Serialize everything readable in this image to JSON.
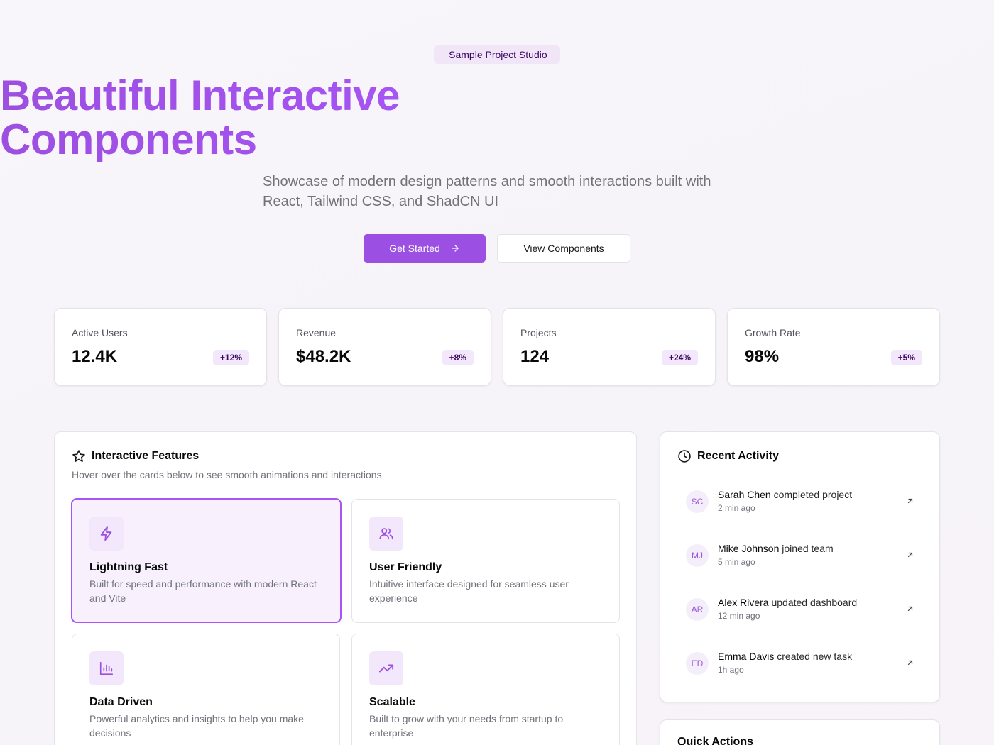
{
  "hero": {
    "badge": " Sample Project Studio",
    "title_line1": "Beautiful Interactive",
    "title_line2": "Components",
    "subtitle": "Showcase of modern design patterns and smooth interactions built with React, Tailwind CSS, and ShadCN UI",
    "primary_button": "Get Started",
    "secondary_button": "View Components"
  },
  "stats": [
    {
      "label": "Active Users",
      "value": "12.4K",
      "delta": "+12%"
    },
    {
      "label": "Revenue",
      "value": "$48.2K",
      "delta": "+8%"
    },
    {
      "label": "Projects",
      "value": "124",
      "delta": "+24%"
    },
    {
      "label": "Growth Rate",
      "value": "98%",
      "delta": "+5%"
    }
  ],
  "features": {
    "title": "Interactive Features",
    "description": "Hover over the cards below to see smooth animations and interactions",
    "cards": [
      {
        "name": "Lightning Fast",
        "description": "Built for speed and performance with modern React and Vite",
        "icon": "lightning-icon"
      },
      {
        "name": "User Friendly",
        "description": "Intuitive interface designed for seamless user experience",
        "icon": "users-icon"
      },
      {
        "name": "Data Driven",
        "description": "Powerful analytics and insights to help you make decisions",
        "icon": "bar-chart-icon"
      },
      {
        "name": "Scalable",
        "description": "Built to grow with your needs from startup to enterprise",
        "icon": "trending-up-icon"
      }
    ]
  },
  "activity": {
    "title": "Recent Activity",
    "items": [
      {
        "initials": "SC",
        "name": "Sarah Chen",
        "action": " completed project",
        "time": "2 min ago"
      },
      {
        "initials": "MJ",
        "name": "Mike Johnson",
        "action": " joined team",
        "time": "5 min ago"
      },
      {
        "initials": "AR",
        "name": "Alex Rivera",
        "action": " updated dashboard",
        "time": "12 min ago"
      },
      {
        "initials": "ED",
        "name": "Emma Davis",
        "action": " created new task",
        "time": "1h ago"
      }
    ]
  },
  "quick_actions": {
    "title": "Quick Actions"
  },
  "colors": {
    "accent": "#a855f7",
    "button": "#9b4fe3",
    "badge_bg": "#f3e8fb"
  }
}
